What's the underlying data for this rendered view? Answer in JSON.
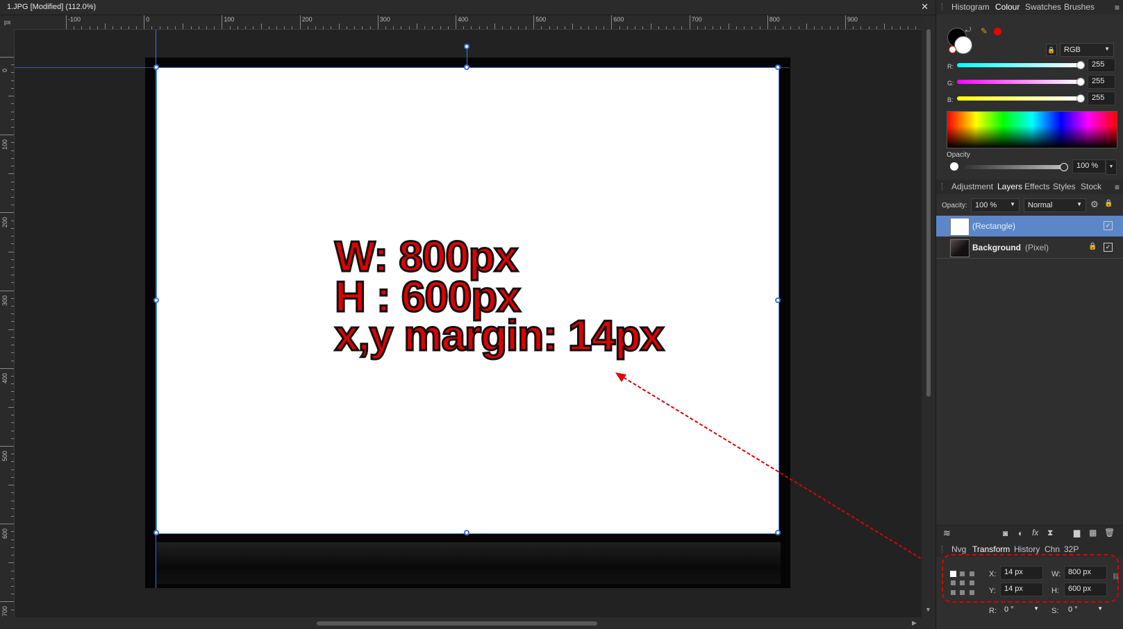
{
  "document": {
    "title": "1.JPG [Modified] (112.0%)",
    "close_glyph": "✕"
  },
  "ruler": {
    "unit": "px",
    "h_ticks": [
      "-100",
      "0",
      "100",
      "200",
      "300",
      "400",
      "500",
      "600",
      "700",
      "800",
      "900"
    ],
    "v_ticks": [
      "0",
      "100",
      "200",
      "300",
      "400",
      "500",
      "600",
      "700"
    ]
  },
  "annotation": {
    "line1": "W: 800px",
    "line2": "H : 600px",
    "line3": "x,y margin: 14px"
  },
  "colour_panel": {
    "tabs": [
      "Histogram",
      "Colour",
      "Swatches",
      "Brushes"
    ],
    "active_tab": "Colour",
    "model": "RGB",
    "r_label": "R:",
    "r_value": "255",
    "g_label": "G:",
    "g_value": "255",
    "b_label": "B:",
    "b_value": "255",
    "opacity_label": "Opacity",
    "opacity_value": "100 %"
  },
  "layers_panel": {
    "tabs": [
      "Adjustment",
      "Layers",
      "Effects",
      "Styles",
      "Stock"
    ],
    "active_tab": "Layers",
    "opacity_label": "Opacity:",
    "opacity_value": "100 %",
    "blend_mode": "Normal",
    "layers": [
      {
        "name": "",
        "type": "(Rectangle)",
        "selected": true
      },
      {
        "name": "Background",
        "type": "(Pixel)",
        "selected": false
      }
    ]
  },
  "transform_panel": {
    "tabs": [
      "Nvg",
      "Transform",
      "History",
      "Chn",
      "32P"
    ],
    "active_tab": "Transform",
    "x_label": "X:",
    "x_value": "14 px",
    "y_label": "Y:",
    "y_value": "14 px",
    "w_label": "W:",
    "w_value": "800 px",
    "h_label": "H:",
    "h_value": "600 px",
    "r_label": "R:",
    "r_value": "0 °",
    "s_label": "S:",
    "s_value": "0 °"
  },
  "colors": {
    "selection": "#3b78d8",
    "annotation_red": "#e00000",
    "layer_selected": "#5b87c9"
  }
}
